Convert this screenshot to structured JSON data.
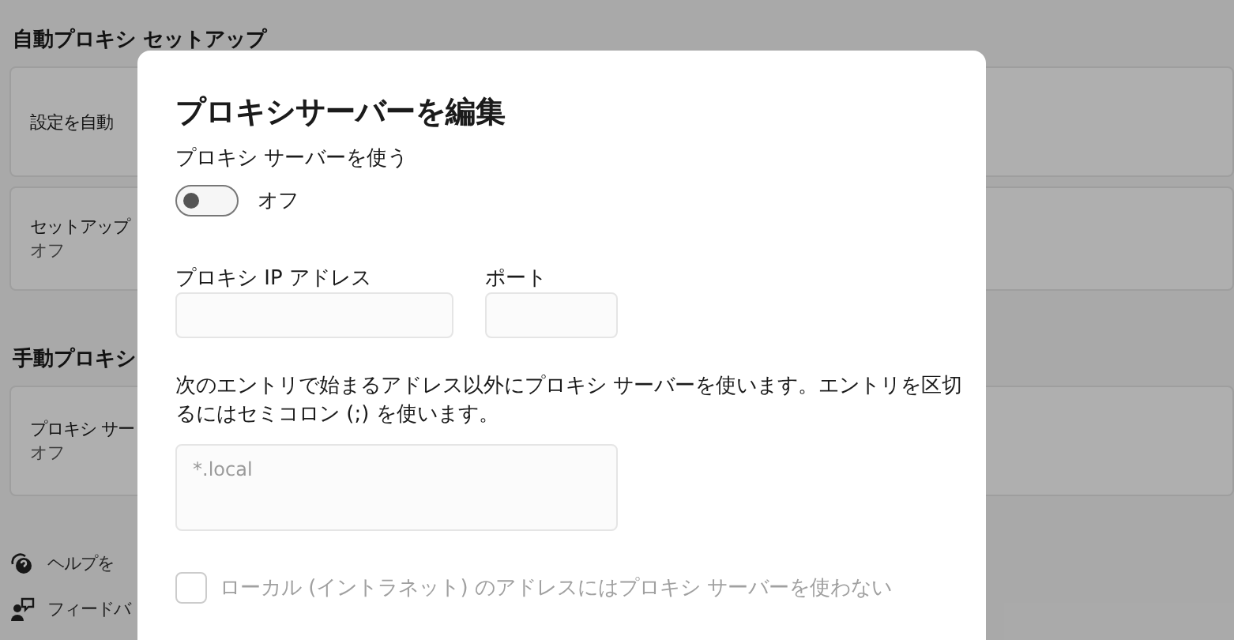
{
  "background": {
    "sections": [
      {
        "title": "自動プロキシ セットアップ",
        "cards": [
          {
            "title": "設定を自動"
          },
          {
            "title": "セットアップ",
            "subtitle": "オフ"
          }
        ]
      },
      {
        "title": "手動プロキシ",
        "cards": [
          {
            "title": "プロキシ サー",
            "subtitle": "オフ"
          }
        ]
      }
    ],
    "links": [
      {
        "kind": "help",
        "label": "ヘルプを"
      },
      {
        "kind": "feedback",
        "label": "フィードバ"
      }
    ]
  },
  "dialog": {
    "title": "プロキシサーバーを編集",
    "toggle": {
      "label": "プロキシ サーバーを使う",
      "on": false,
      "state_text": "オフ"
    },
    "fields": [
      {
        "kind": "ip",
        "label": "プロキシ IP アドレス"
      },
      {
        "kind": "port",
        "label": "ポート"
      }
    ],
    "exceptions": {
      "description": "次のエントリで始まるアドレス以外にプロキシ サーバーを使います。エントリを区切るにはセミコロン (;) を使います。",
      "placeholder": "*.local"
    },
    "checkbox": {
      "label": "ローカル (イントラネット) のアドレスにはプロキシ サーバーを使わない",
      "checked": false,
      "disabled": true
    }
  }
}
